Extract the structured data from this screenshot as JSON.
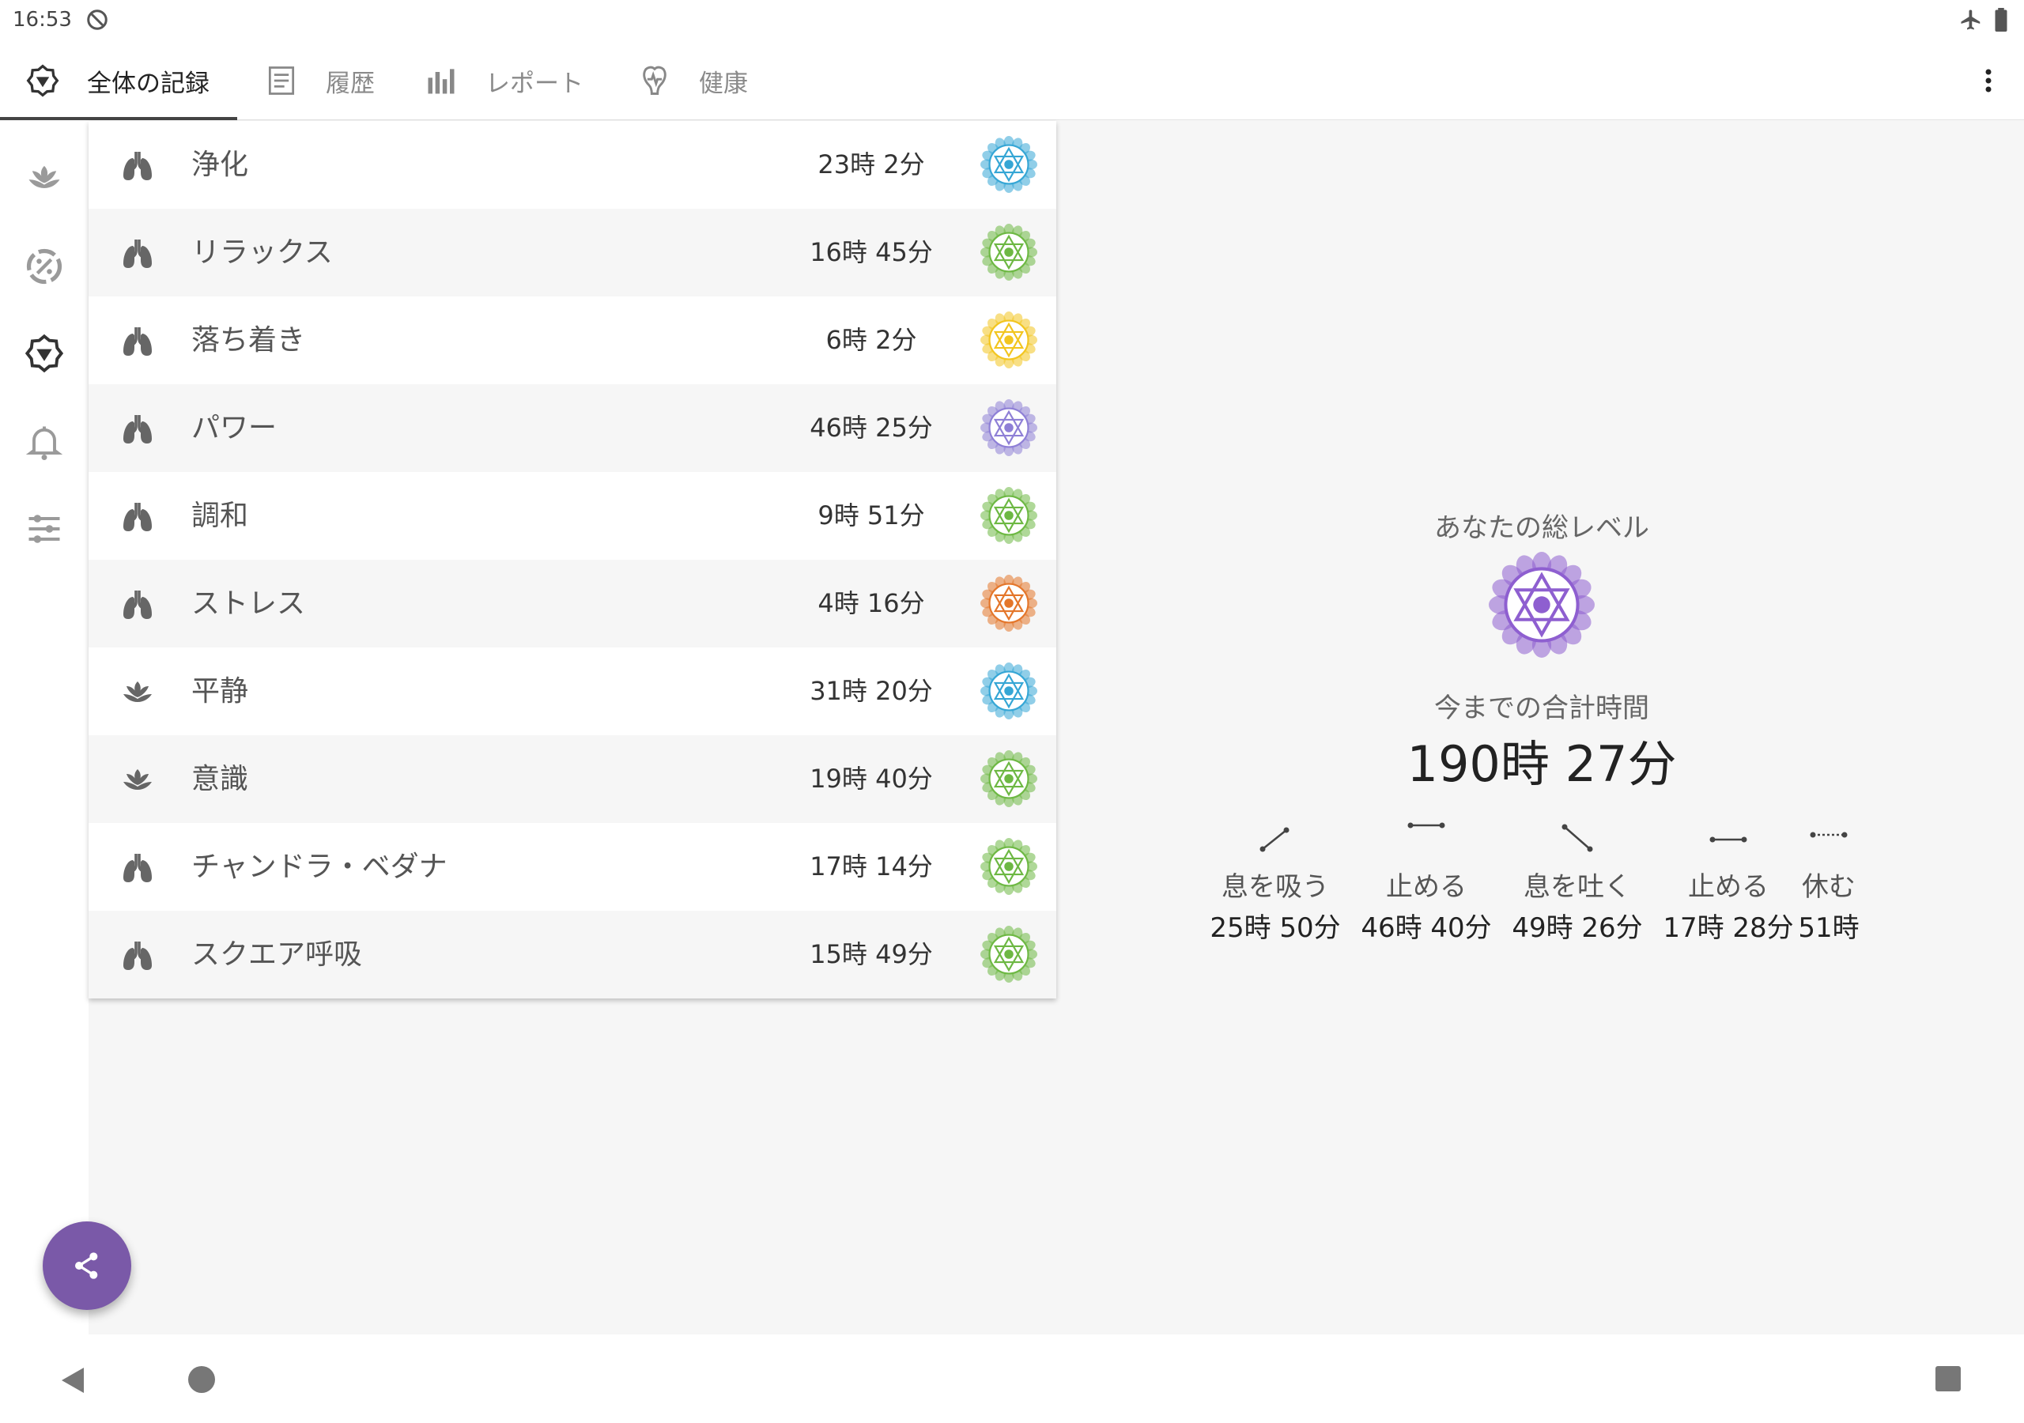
{
  "status_bar": {
    "time": "16:53"
  },
  "tabs": [
    {
      "label": "全体の記録",
      "icon": "chakra-emblem-icon",
      "active": true
    },
    {
      "label": "履歴",
      "icon": "history-list-icon",
      "active": false
    },
    {
      "label": "レポート",
      "icon": "bar-chart-icon",
      "active": false
    },
    {
      "label": "健康",
      "icon": "health-icon",
      "active": false
    }
  ],
  "side_rail": [
    {
      "icon": "lotus-icon"
    },
    {
      "icon": "pranayama-timer-icon"
    },
    {
      "icon": "chakra-emblem-icon",
      "active": true
    },
    {
      "icon": "bell-icon"
    },
    {
      "icon": "sliders-icon"
    }
  ],
  "records": [
    {
      "icon": "lungs-icon",
      "name": "浄化",
      "time": "23時 2分",
      "chakra_color": "#35a6d5"
    },
    {
      "icon": "lungs-icon",
      "name": "リラックス",
      "time": "16時 45分",
      "chakra_color": "#6db843"
    },
    {
      "icon": "lungs-icon",
      "name": "落ち着き",
      "time": "6時 2分",
      "chakra_color": "#f2c51f"
    },
    {
      "icon": "lungs-icon",
      "name": "パワー",
      "time": "46時 25分",
      "chakra_color": "#8e7fd6"
    },
    {
      "icon": "lungs-icon",
      "name": "調和",
      "time": "9時 51分",
      "chakra_color": "#6db843"
    },
    {
      "icon": "lungs-icon",
      "name": "ストレス",
      "time": "4時 16分",
      "chakra_color": "#e4762a"
    },
    {
      "icon": "lotus-icon",
      "name": "平静",
      "time": "31時 20分",
      "chakra_color": "#35a6d5"
    },
    {
      "icon": "lotus-icon",
      "name": "意識",
      "time": "19時 40分",
      "chakra_color": "#6db843"
    },
    {
      "icon": "lungs-icon",
      "name": "チャンドラ・ベダナ",
      "time": "17時 14分",
      "chakra_color": "#6db843"
    },
    {
      "icon": "lungs-icon",
      "name": "スクエア呼吸",
      "time": "15時 49分",
      "chakra_color": "#6db843"
    }
  ],
  "summary": {
    "level_label": "あなたの総レベル",
    "level_chakra_color": "#8e5fd0",
    "total_label": "今までの合計時間",
    "total_value": "190時 27分",
    "phases": [
      {
        "icon": "inhale-icon",
        "name": "息を吸う",
        "value": "25時 50分"
      },
      {
        "icon": "hold-icon",
        "name": "止める",
        "value": "46時 40分"
      },
      {
        "icon": "exhale-icon",
        "name": "息を吐く",
        "value": "49時 26分"
      },
      {
        "icon": "hold-icon",
        "name": "止める",
        "value": "17時 28分"
      },
      {
        "icon": "rest-icon",
        "name": "休む",
        "value": "51時"
      }
    ]
  },
  "fab": {
    "icon": "share-icon"
  },
  "colors": {
    "accent": "#7a59a8"
  }
}
